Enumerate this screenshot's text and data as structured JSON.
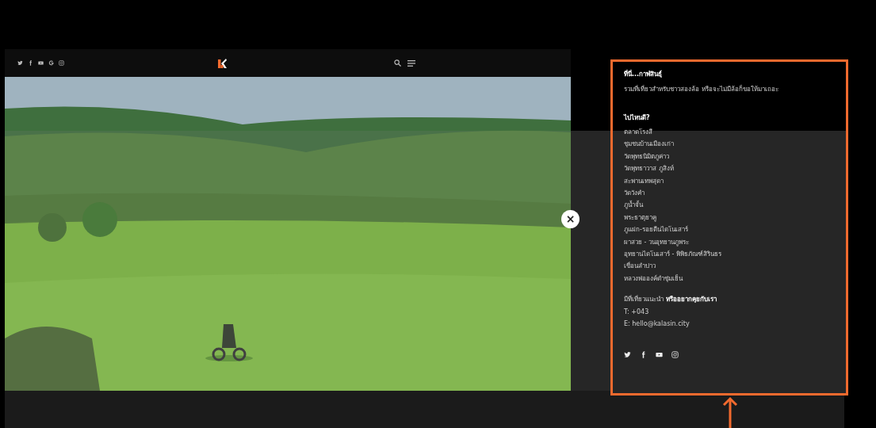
{
  "header": {
    "social_links": [
      {
        "kind": "twitter"
      },
      {
        "kind": "facebook"
      },
      {
        "kind": "youtube"
      },
      {
        "kind": "google"
      },
      {
        "kind": "instagram"
      }
    ]
  },
  "close_button": {
    "label": "×"
  },
  "menu": {
    "title": "ที่นี่...กาฬสินธุ์",
    "description": "รวมที่เที่ยวสำหรับชาวสองล้อ หรือจะไม่มีล้อก็ขอให้มาเถอะ",
    "places_heading": "ไปไหนดี?",
    "places": [
      "ตลาดโรงสี",
      "ชุมชนบ้านเมืองเก่า",
      "วัดพุทธนิมิตภูค่าว",
      "วัดพุทธาวาส ภูสิงห์",
      "สะพานเทพสุดา",
      "วัดวังคำ",
      "ภูน้ำจั้น",
      "พระธาตุยาคู",
      "ภูแฝก-รอยตีนไดโนเสาร์",
      "ผาสวย - วนอุทยานภูพระ",
      "อุทยานไดโนเสาร์ - พิพิธภัณฑ์สิรินธร",
      "เขื่อนลำปาว",
      "หลวงพ่อองค์ดำชุ่มเย็น"
    ],
    "contact_heading": "มีที่เที่ยวแนะนำ **หรืออยากคุยกับเรา**",
    "phone": "T: +043",
    "email": "E: hello@kalasin.city",
    "social_links": [
      {
        "kind": "twitter"
      },
      {
        "kind": "facebook"
      },
      {
        "kind": "youtube"
      },
      {
        "kind": "instagram"
      }
    ]
  }
}
